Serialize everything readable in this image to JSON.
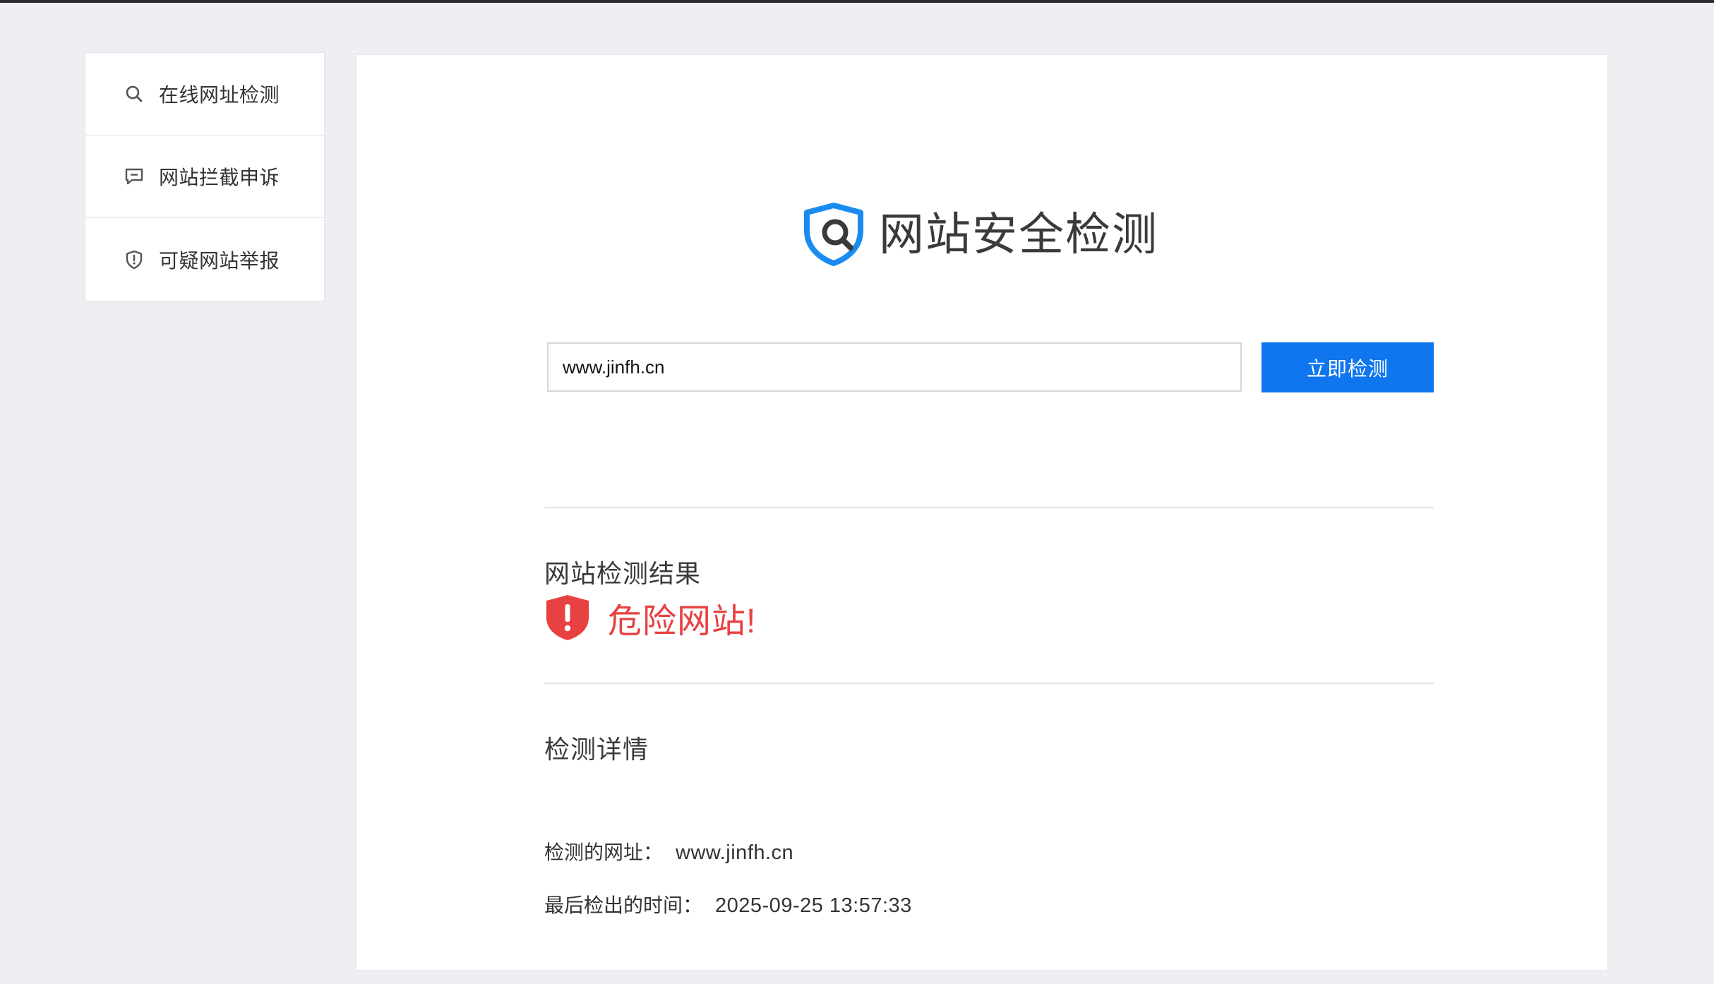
{
  "sidebar": {
    "items": [
      {
        "label": "在线网址检测",
        "icon": "search-icon"
      },
      {
        "label": "网站拦截申诉",
        "icon": "message-icon"
      },
      {
        "label": "可疑网站举报",
        "icon": "shield-alert-icon"
      }
    ]
  },
  "main": {
    "brand_title": "网站安全检测",
    "search_value": "www.jinfh.cn",
    "search_button": "立即检测",
    "result_heading": "网站检测结果",
    "result_status": "危险网站!",
    "details_heading": "检测详情",
    "details": [
      {
        "label": "检测的网址：",
        "value": "www.jinfh.cn"
      },
      {
        "label": "最后检出的时间：",
        "value": "2025-09-25 13:57:33"
      }
    ]
  },
  "colors": {
    "accent": "#0f76f0",
    "danger": "#e84141",
    "background": "#efeff3"
  }
}
